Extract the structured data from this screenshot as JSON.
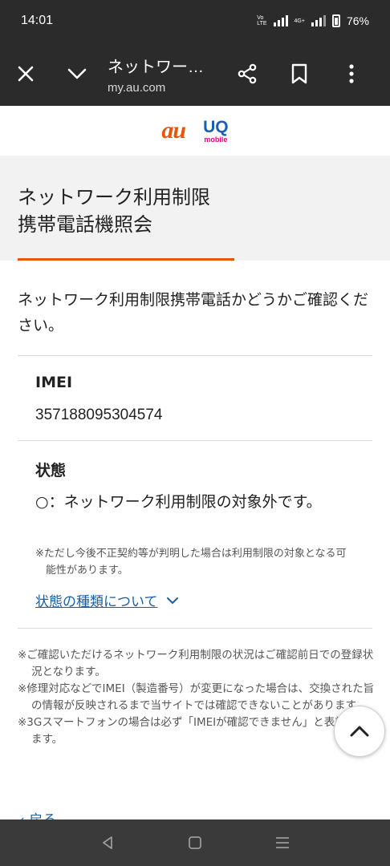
{
  "status_bar": {
    "time": "14:01",
    "volte_label": "Vo\nLTE",
    "network_label": "4G+",
    "battery_percent": "76%"
  },
  "browser": {
    "page_title": "ネットワー…",
    "url": "my.au.com"
  },
  "logos": {
    "au": "au",
    "uq": "UQ",
    "uq_sub": "mobile"
  },
  "page": {
    "title_line1": "ネットワーク利用制限",
    "title_line2": "携帯電話機照会",
    "intro": "ネットワーク利用制限携帯電話かどうかご確認ください。"
  },
  "imei": {
    "label": "IMEI",
    "value": "357188095304574"
  },
  "status": {
    "label": "状態",
    "result": "○：ネットワーク利用制限の対象外です。",
    "note": "※ただし今後不正契約等が判明した場合は利用制限の対象となる可能性があります。",
    "types_link": "状態の種類について"
  },
  "notes": [
    "※ご確認いただけるネットワーク利用制限の状況はご確認前日での登録状況となります。",
    "※修理対応などでIMEI（製造番号）が変更になった場合は、交換された旨の情報が反映されるまで当サイトでは確認できないことがあります。",
    "※3Gスマートフォンの場合は必ず「IMEIが確認できません」と表記されます。"
  ],
  "back_link": "戻る",
  "colors": {
    "accent": "#eb5505",
    "link": "#1b5fa3",
    "bar_bg": "#2b2b2b"
  }
}
